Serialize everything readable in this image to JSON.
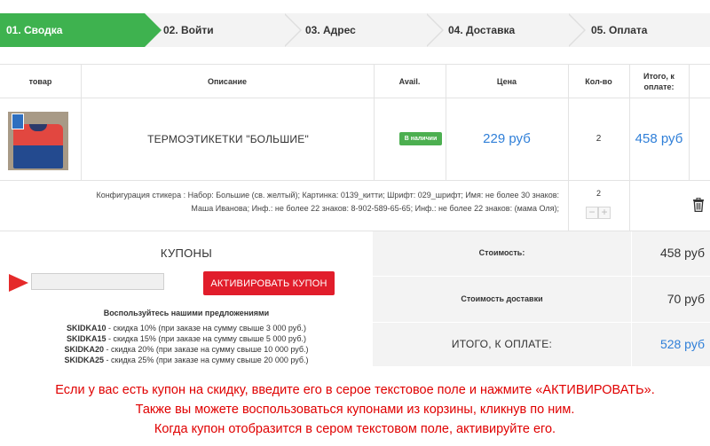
{
  "steps": [
    {
      "label": "01. Сводка",
      "active": true
    },
    {
      "label": "02. Войти",
      "active": false
    },
    {
      "label": "03. Адрес",
      "active": false
    },
    {
      "label": "04. Доставка",
      "active": false
    },
    {
      "label": "05. Оплата",
      "active": false
    }
  ],
  "table": {
    "headers": {
      "product": "товар",
      "description": "Описание",
      "avail": "Avail.",
      "price": "Цена",
      "qty": "Кол-во",
      "total_line1": "Итого, к",
      "total_line2": "оплате:"
    },
    "item": {
      "name": "ТЕРМОЭТИКЕТКИ \"БОЛЬШИЕ\"",
      "availability": "В наличии",
      "price": "229 руб",
      "quantity": "2",
      "total": "458 руб"
    },
    "config_row": {
      "line1": "Конфигурация стикера : Набор: Большие (св. желтый); Картинка: 0139_китти; Шрифт: 029_шрифт; Имя: не более 30 знаков:",
      "line2": "Маша Иванова; Инф.: не более 22 знаков: 8-902-589-65-65; Инф.: не более 22 знаков: (мама Оля);",
      "quantity": "2",
      "minus": "−",
      "plus": "+"
    }
  },
  "coupons": {
    "title": "КУПОНЫ",
    "input_value": "",
    "activate_button": "АКТИВИРОВАТЬ КУПОН",
    "offers_title": "Воспользуйтесь нашими предложениями",
    "offers": [
      {
        "code": "SKIDKA10",
        "text": " - скидка 10% (при заказе на сумму свыше 3 000 руб.)"
      },
      {
        "code": "SKIDKA15",
        "text": " - скидка 15% (при заказе на сумму свыше 5 000 руб.)"
      },
      {
        "code": "SKIDKA20",
        "text": " - скидка 20% (при заказе на сумму свыше 10 000 руб.)"
      },
      {
        "code": "SKIDKA25",
        "text": " - скидка 25% (при заказе на сумму свыше 20 000 руб.)"
      }
    ]
  },
  "summary": {
    "cost_label": "Стоимость:",
    "cost_value": "458 руб",
    "shipping_label": "Стоимость доставки",
    "shipping_value": "70 руб",
    "total_label": "ИТОГО, К ОПЛАТЕ:",
    "total_value": "528 руб"
  },
  "instructions": [
    "Если у вас есть купон на скидку, введите его в серое текстовое поле и нажмите «АКТИВИРОВАТЬ».",
    "Также вы можете воспользоваться купонами из корзины, кликнув по ним.",
    "Когда купон отобразится в сером текстовом поле, активируйте его."
  ],
  "colors": {
    "active_step": "#3eb24f",
    "price_blue": "#2f7fd8",
    "button_red": "#e11d2b",
    "instruction_red": "#e00000",
    "in_stock_green": "#4caf50"
  },
  "icons": [
    "play-arrow-icon",
    "minus-icon",
    "plus-icon",
    "trash-icon"
  ]
}
